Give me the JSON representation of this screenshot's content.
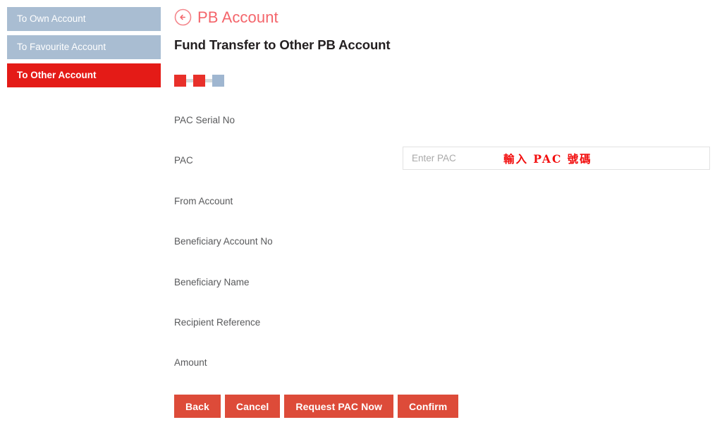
{
  "sidebar": {
    "items": [
      {
        "label": "To Own Account",
        "active": false
      },
      {
        "label": "To Favourite Account",
        "active": false
      },
      {
        "label": "To Other Account",
        "active": true
      }
    ]
  },
  "header": {
    "back_icon": "circle-arrow-left-icon",
    "brand_title": "PB Account",
    "page_title": "Fund Transfer to Other PB Account"
  },
  "steps": {
    "items": [
      {
        "state": "done"
      },
      {
        "state": "done"
      },
      {
        "state": "todo"
      }
    ]
  },
  "form": {
    "rows": [
      {
        "label": "PAC Serial No"
      },
      {
        "label": "PAC"
      },
      {
        "label": "From Account"
      },
      {
        "label": "Beneficiary Account No"
      },
      {
        "label": "Beneficiary Name"
      },
      {
        "label": "Recipient Reference"
      },
      {
        "label": "Amount"
      }
    ],
    "pac_input": {
      "placeholder": "Enter PAC",
      "value": "",
      "annotation": "輸入 PAC 號碼"
    }
  },
  "buttons": [
    {
      "label": "Back"
    },
    {
      "label": "Cancel"
    },
    {
      "label": "Request PAC Now"
    },
    {
      "label": "Confirm"
    }
  ],
  "colors": {
    "active_red": "#e41b17",
    "sidebar_blue": "#a9bdd2",
    "brand_pink": "#f4656b",
    "button_red": "#dd4b39",
    "step_done": "#e8302a",
    "step_todo": "#9fb6d0",
    "annotation_red": "#f20d0d"
  }
}
